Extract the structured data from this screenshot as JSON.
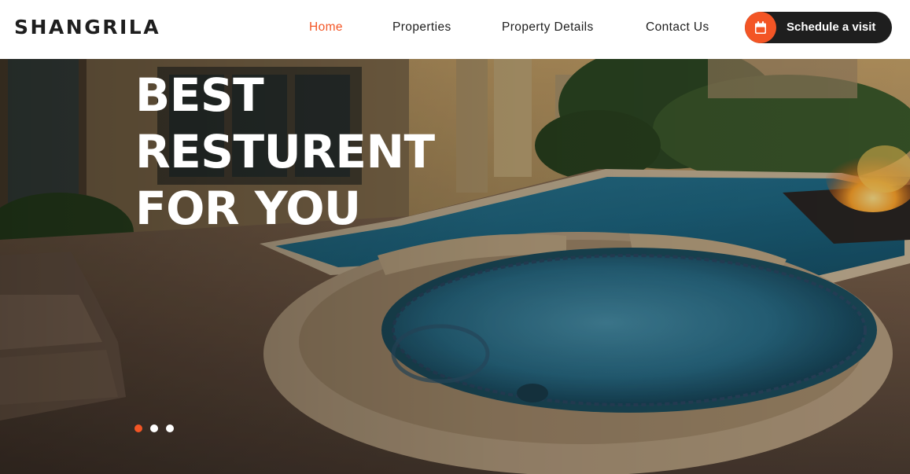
{
  "brand": {
    "logo": "SHANGRILA"
  },
  "nav": {
    "items": [
      {
        "label": "Home",
        "active": true
      },
      {
        "label": "Properties",
        "active": false
      },
      {
        "label": "Property Details",
        "active": false
      },
      {
        "label": "Contact Us",
        "active": false
      }
    ],
    "cta_label": "Schedule a visit",
    "cta_icon": "calendar-icon"
  },
  "hero": {
    "title_lines": [
      "BEST",
      "RESTURENT",
      "FOR YOU"
    ],
    "slides": {
      "count": 3,
      "active_index": 0
    }
  },
  "colors": {
    "accent": "#f35525",
    "dark": "#1e1e1e",
    "header_bg": "#ffffff"
  }
}
